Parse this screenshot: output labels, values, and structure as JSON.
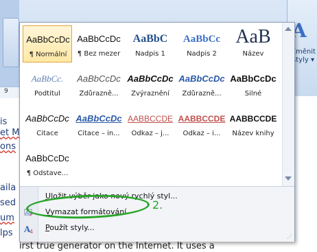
{
  "ribbon": {
    "change_styles_label": "Změnit styly ▾",
    "ruler_marker": "9"
  },
  "document": {
    "left_fragments": [
      "is",
      "et M",
      "ons",
      "aila",
      "sed",
      "um",
      "lps"
    ],
    "bottom_line": "irst true generator on the Internet. It uses a"
  },
  "gallery": {
    "tiles": [
      {
        "sample": "AaBbCcDc",
        "label": "¶ Normální",
        "selected": true
      },
      {
        "sample": "AaBbCcDc",
        "label": "¶ Bez mezer",
        "selected": false
      },
      {
        "sample": "AaBbC",
        "label": "Nadpis 1",
        "selected": false
      },
      {
        "sample": "AaBbCc",
        "label": "Nadpis 2",
        "selected": false
      },
      {
        "sample": "AaB",
        "label": "Název",
        "selected": false
      },
      {
        "sample": "AaBbCc.",
        "label": "Podtitul",
        "selected": false
      },
      {
        "sample": "AaBbCcDc",
        "label": "Zdůrazně...",
        "selected": false
      },
      {
        "sample": "AaBbCcDc",
        "label": "Zvýraznění",
        "selected": false
      },
      {
        "sample": "AaBbCcDc",
        "label": "Zdůrazně...",
        "selected": false
      },
      {
        "sample": "AaBbCcDc",
        "label": "Silné",
        "selected": false
      },
      {
        "sample": "AaBbCcDc",
        "label": "Citace",
        "selected": false
      },
      {
        "sample": "AaBbCcDc",
        "label": "Citace – in...",
        "selected": false
      },
      {
        "sample": "AABBCCDE",
        "label": "Odkaz – j...",
        "selected": false
      },
      {
        "sample": "AABBCCDE",
        "label": "Odkaz – i...",
        "selected": false
      },
      {
        "sample": "AABBCCDE",
        "label": "Název knihy",
        "selected": false
      },
      {
        "sample": "AaBbCcDc",
        "label": "¶ Odstave...",
        "selected": false
      }
    ]
  },
  "menu": {
    "items": [
      {
        "label": "Uložit výběr jako nový rychlý styl...",
        "underline_char": "U",
        "disabled": false,
        "icon": "save-style-icon"
      },
      {
        "label": "Vymazat formátování",
        "underline_char": "V",
        "disabled": false,
        "icon": "clear-formatting-icon"
      },
      {
        "label": "Použít styly...",
        "underline_char": "P",
        "disabled": false,
        "icon": "apply-styles-icon"
      }
    ]
  },
  "annotation": {
    "label": "2.",
    "color": "#2aa42a"
  },
  "colors": {
    "selected_border": "#e3a23a",
    "accent_blue": "#3a6fc4",
    "reference_red": "#c0504d"
  }
}
